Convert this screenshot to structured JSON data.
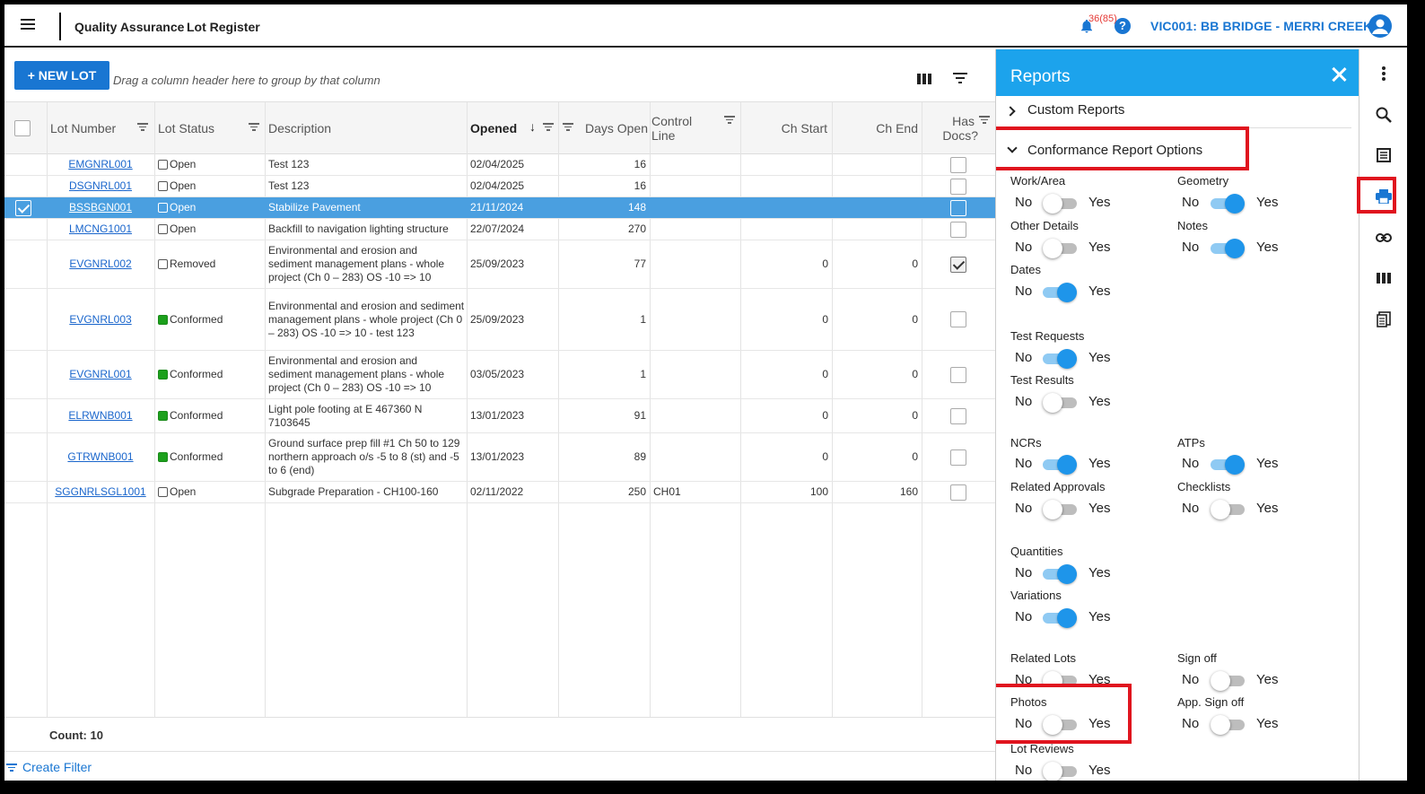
{
  "header": {
    "app_title": "Quality Assurance",
    "page_title": "Lot Register",
    "notification_count": "36(85)",
    "help_label": "?",
    "project": "VIC001: BB BRIDGE - MERRI CREEK"
  },
  "toolbar": {
    "new_lot_label": "+ NEW LOT",
    "group_hint": "Drag a column header here to group by that column"
  },
  "grid": {
    "columns": {
      "lot_number": "Lot Number",
      "lot_status": "Lot Status",
      "description": "Description",
      "opened": "Opened",
      "sort_indicator": "↓",
      "days_open": "Days Open",
      "control_line_1": "Control",
      "control_line_2": "Line",
      "ch_start": "Ch Start",
      "ch_end": "Ch End",
      "has_docs_1": "Has",
      "has_docs_2": "Docs?"
    },
    "rows": [
      {
        "lot": "EMGNRL001",
        "status": "Open",
        "desc": "Test 123",
        "opened": "02/04/2025",
        "days": "16",
        "control": "",
        "ch_start": "",
        "ch_end": ""
      },
      {
        "lot": "DSGNRL001",
        "status": "Open",
        "desc": "Test 123",
        "opened": "02/04/2025",
        "days": "16",
        "control": "",
        "ch_start": "",
        "ch_end": ""
      },
      {
        "lot": "BSSBGN001",
        "status": "Open",
        "desc": "Stabilize Pavement",
        "opened": "21/11/2024",
        "days": "148",
        "control": "",
        "ch_start": "",
        "ch_end": ""
      },
      {
        "lot": "LMCNG1001",
        "status": "Open",
        "desc": "Backfill to navigation lighting structure",
        "opened": "22/07/2024",
        "days": "270",
        "control": "",
        "ch_start": "",
        "ch_end": ""
      },
      {
        "lot": "EVGNRL002",
        "status": "Removed",
        "desc": "Environmental and erosion and sediment management plans - whole project (Ch 0 – 283) OS -10 => 10",
        "opened": "25/09/2023",
        "days": "77",
        "control": "",
        "ch_start": "0",
        "ch_end": "0"
      },
      {
        "lot": "EVGNRL003",
        "status": "Conformed",
        "desc": "Environmental and erosion and sediment management plans - whole project (Ch 0 – 283) OS -10 => 10 - test 123",
        "opened": "25/09/2023",
        "days": "1",
        "control": "",
        "ch_start": "0",
        "ch_end": "0"
      },
      {
        "lot": "EVGNRL001",
        "status": "Conformed",
        "desc": "Environmental and erosion and sediment management plans - whole project (Ch 0 – 283) OS -10 => 10",
        "opened": "03/05/2023",
        "days": "1",
        "control": "",
        "ch_start": "0",
        "ch_end": "0"
      },
      {
        "lot": "ELRWNB001",
        "status": "Conformed",
        "desc": "Light pole footing at E 467360 N 7103645",
        "opened": "13/01/2023",
        "days": "91",
        "control": "",
        "ch_start": "0",
        "ch_end": "0"
      },
      {
        "lot": "GTRWNB001",
        "status": "Conformed",
        "desc": "Ground surface prep fill #1 Ch 50 to 129 northern approach o/s -5 to 8 (st) and -5 to 6 (end)",
        "opened": "13/01/2023",
        "days": "89",
        "control": "",
        "ch_start": "0",
        "ch_end": "0"
      },
      {
        "lot": "SGGNRLSGL1001",
        "status": "Open",
        "desc": "Subgrade Preparation - CH100-160",
        "opened": "02/11/2022",
        "days": "250",
        "control": "CH01",
        "ch_start": "100",
        "ch_end": "160"
      }
    ],
    "count_label": "Count: 10",
    "create_filter": "Create Filter"
  },
  "reports": {
    "title": "Reports",
    "custom_reports": "Custom Reports",
    "conformance_options": "Conformance Report Options",
    "no": "No",
    "yes": "Yes",
    "options": {
      "work_area": "Work/Area",
      "geometry": "Geometry",
      "other_details": "Other Details",
      "notes": "Notes",
      "dates": "Dates",
      "test_requests": "Test Requests",
      "test_results": "Test Results",
      "ncrs": "NCRs",
      "atps": "ATPs",
      "related_approvals": "Related Approvals",
      "checklists": "Checklists",
      "quantities": "Quantities",
      "variations": "Variations",
      "related_lots": "Related Lots",
      "sign_off": "Sign off",
      "photos": "Photos",
      "app_sign_off": "App. Sign off",
      "lot_reviews": "Lot Reviews"
    }
  },
  "colors": {
    "accent": "#1976d2",
    "panel_header": "#1ca3ec",
    "selected_row": "#4a9fe0",
    "highlight": "#e0141e",
    "conformed": "#1ca01c"
  }
}
